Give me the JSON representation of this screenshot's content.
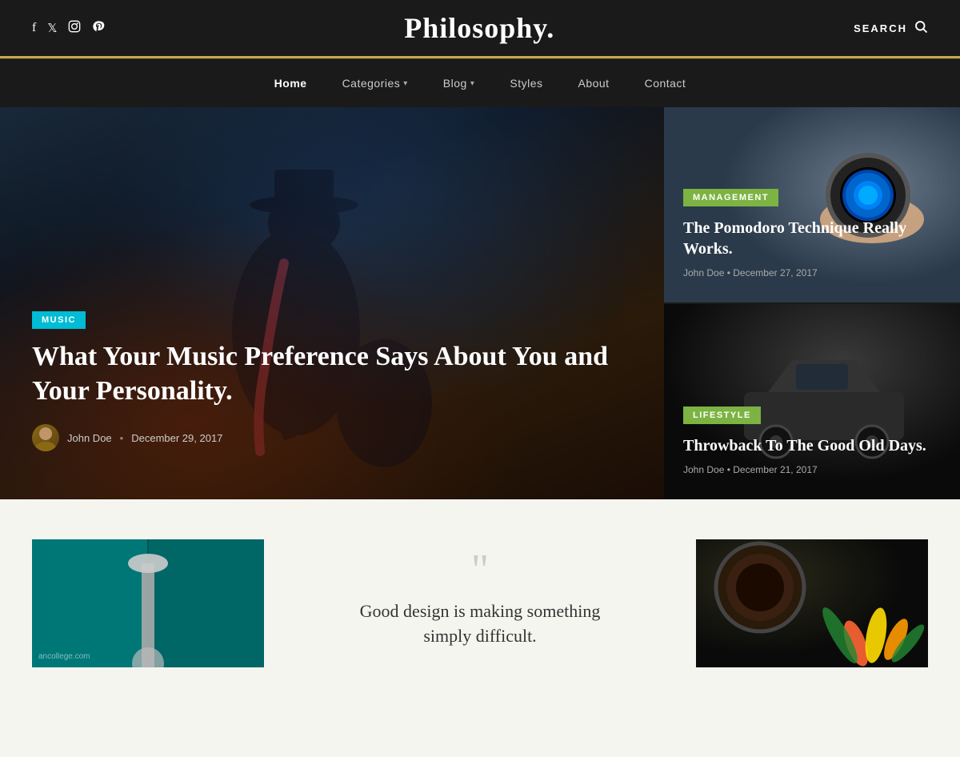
{
  "header": {
    "site_title": "Philosophy.",
    "search_label": "SEARCH",
    "social_icons": [
      "f",
      "🐦",
      "📷",
      "🅟"
    ]
  },
  "nav": {
    "items": [
      {
        "label": "Home",
        "active": true,
        "has_dropdown": false
      },
      {
        "label": "Categories",
        "active": false,
        "has_dropdown": true
      },
      {
        "label": "Blog",
        "active": false,
        "has_dropdown": true
      },
      {
        "label": "Styles",
        "active": false,
        "has_dropdown": false
      },
      {
        "label": "About",
        "active": false,
        "has_dropdown": false
      },
      {
        "label": "Contact",
        "active": false,
        "has_dropdown": false
      }
    ]
  },
  "hero": {
    "main": {
      "category": "MUSIC",
      "title": "What Your Music Preference Says About You and Your Personality.",
      "author": "John Doe",
      "date": "December 29, 2017"
    },
    "right_top": {
      "category": "MANAGEMENT",
      "title": "The Pomodoro Technique Really Works.",
      "author": "John Doe",
      "date": "December 27, 2017"
    },
    "right_bottom": {
      "category": "LIFESTYLE",
      "title": "Throwback To The Good Old Days.",
      "author": "John Doe",
      "date": "December 21, 2017"
    }
  },
  "bottom": {
    "quote": {
      "text": "Good design is making something",
      "text2": "simply difficult."
    },
    "watermark": "ancollege.com"
  }
}
